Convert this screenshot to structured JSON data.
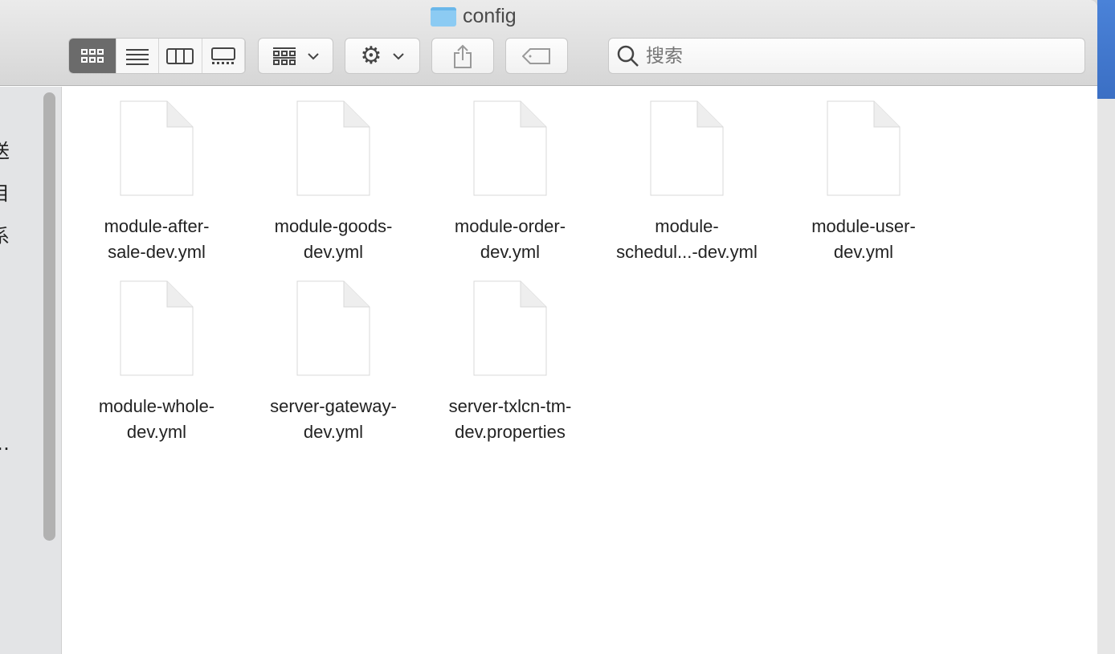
{
  "window": {
    "title": "config"
  },
  "toolbar": {
    "view_icon": "icon-view-button",
    "list_view": "list-view-button",
    "column_view": "column-view-button",
    "gallery_view": "gallery-view-button",
    "search_placeholder": "搜索"
  },
  "sidebar": {
    "items": [
      "送",
      "目",
      "系",
      "…"
    ]
  },
  "files": [
    {
      "line1": "module-after-",
      "line2": "sale-dev.yml"
    },
    {
      "line1": "module-goods-",
      "line2": "dev.yml"
    },
    {
      "line1": "module-order-",
      "line2": "dev.yml"
    },
    {
      "line1": "module-",
      "line2": "schedul...-dev.yml"
    },
    {
      "line1": "module-user-",
      "line2": "dev.yml"
    },
    {
      "line1": "module-whole-",
      "line2": "dev.yml"
    },
    {
      "line1": "server-gateway-",
      "line2": "dev.yml"
    },
    {
      "line1": "server-txlcn-tm-",
      "line2": "dev.properties"
    }
  ]
}
